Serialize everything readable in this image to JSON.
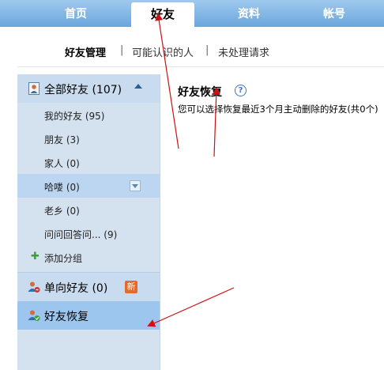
{
  "nav": {
    "tabs": [
      {
        "label": "首页"
      },
      {
        "label": "好友"
      },
      {
        "label": "资料"
      },
      {
        "label": "帐号"
      }
    ]
  },
  "subnav": {
    "items": [
      {
        "label": "好友管理"
      },
      {
        "label": "可能认识的人"
      },
      {
        "label": "未处理请求"
      }
    ],
    "separator": "|"
  },
  "sidebar": {
    "all_friends": {
      "label": "全部好友 (107)"
    },
    "groups": [
      {
        "label": "我的好友 (95)"
      },
      {
        "label": "朋友 (3)"
      },
      {
        "label": "家人 (0)"
      },
      {
        "label": "哈喽 (0)"
      },
      {
        "label": "老乡 (0)"
      },
      {
        "label": "问问回答问... (9)"
      }
    ],
    "add_group": {
      "label": "添加分组"
    },
    "one_way": {
      "label": "单向好友 (0)",
      "badge": "新"
    },
    "recover": {
      "label": "好友恢复"
    }
  },
  "main": {
    "title": "好友恢复",
    "help": "?",
    "description": "您可以选择恢复最近3个月主动删除的好友(共0个)"
  },
  "colors": {
    "nav_blue": "#6aa6dc",
    "sidebar_bg": "#d4e1ef",
    "selected_row": "#bcd5f0",
    "recover_row": "#9cc6ee",
    "badge_orange": "#e46a2c",
    "arrow_red": "#cc1111"
  }
}
